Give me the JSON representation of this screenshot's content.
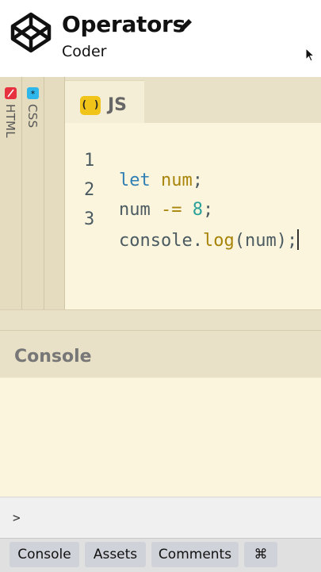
{
  "header": {
    "title": "Operators",
    "subtitle": "Coder",
    "logo_icon": "codepen-logo-icon",
    "edit_icon": "pencil-icon"
  },
  "side_tabs": [
    {
      "label": "HTML",
      "icon": "html-badge-icon",
      "color": "#e8313f"
    },
    {
      "label": "CSS",
      "icon": "css-badge-icon",
      "color": "#2fb6ea"
    }
  ],
  "js_tab": {
    "label": "JS",
    "badge": "( )",
    "badge_color": "#f0c419"
  },
  "code_lines": [
    {
      "num": "1",
      "text": "let num;"
    },
    {
      "num": "2",
      "text": "num -= 8;"
    },
    {
      "num": "3",
      "text": "console.log(num);"
    }
  ],
  "console": {
    "title": "Console",
    "prompt": ">"
  },
  "bottom_bar": {
    "console": "Console",
    "assets": "Assets",
    "comments": "Comments",
    "shortcuts": "⌘"
  },
  "colors": {
    "editor_bg": "#fbf5dd",
    "panel_bg": "#e8e1c7",
    "keyword": "#2f7fb5",
    "variable": "#a8850a",
    "number": "#2aa198"
  }
}
